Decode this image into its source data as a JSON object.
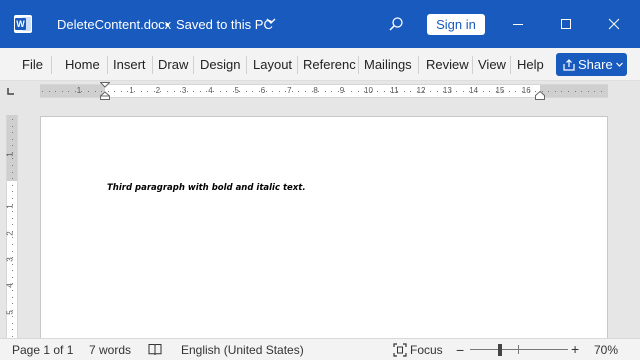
{
  "titlebar": {
    "doc_name": "DeleteContent.docx",
    "separator": "•",
    "save_status": "Saved to this PC",
    "signin_label": "Sign in",
    "app_icon_letter": "W",
    "accent": "#185abd"
  },
  "ribbon": {
    "tabs": [
      "File",
      "Home",
      "Insert",
      "Draw",
      "Design",
      "Layout",
      "Referenc",
      "Mailings",
      "Review",
      "View",
      "Help"
    ],
    "share_label": "Share"
  },
  "ruler": {
    "h_numbers": [
      "1",
      "1",
      "2",
      "3",
      "4",
      "5",
      "6",
      "7",
      "8",
      "9",
      "10",
      "11",
      "12",
      "13",
      "14",
      "15",
      "16"
    ],
    "v_numbers": [
      "1",
      "1",
      "2",
      "3",
      "4",
      "5"
    ]
  },
  "document": {
    "paragraph": "Third paragraph with bold and italic text."
  },
  "statusbar": {
    "page": "Page 1 of 1",
    "words": "7 words",
    "language": "English (United States)",
    "focus": "Focus",
    "zoom_minus": "−",
    "zoom_plus": "+",
    "zoom": "70%"
  }
}
